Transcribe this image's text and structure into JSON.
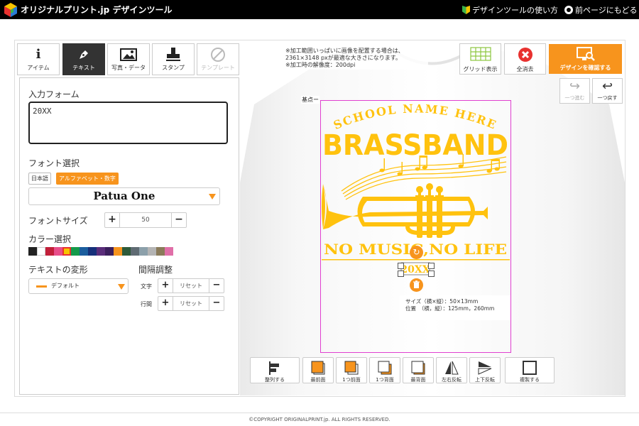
{
  "header": {
    "brand": "オリジナルプリント.jp デザインツール",
    "howto": "デザインツールの使い方",
    "back": "前ページにもどる"
  },
  "tabs": [
    {
      "label": "アイテム",
      "icon": "info-icon"
    },
    {
      "label": "テキスト",
      "icon": "pen-icon",
      "active": true
    },
    {
      "label": "写真・データ",
      "icon": "image-icon"
    },
    {
      "label": "スタンプ",
      "icon": "stamp-icon"
    },
    {
      "label": "テンプレート",
      "icon": "template-icon",
      "disabled": true
    }
  ],
  "form": {
    "input_label": "入力フォーム",
    "input_value": "20XX",
    "font_label": "フォント選択",
    "font_tab_jp": "日本語",
    "font_tab_alpha": "アルファベット・数字",
    "font_value": "Patua One",
    "size_label": "フォントサイズ",
    "size_plus": "+",
    "size_value": "50",
    "size_minus": "−",
    "color_label": "カラー選択",
    "transform_label": "テキストの変形",
    "transform_value": "デフォルト",
    "spacing_label": "間隔調整",
    "char_label": "文字",
    "line_label": "行間",
    "reset": "リセット",
    "plus": "+",
    "minus": "−"
  },
  "palette": [
    "#222222",
    "#ffffff",
    "#c21f3a",
    "#e84d8a",
    "#f7c400",
    "#159a4b",
    "#1b5e9e",
    "#16307a",
    "#5a2d7a",
    "#3b1f5c",
    "#f7941d",
    "#2d5a3a",
    "#5f6b73",
    "#8ca0aa",
    "#b4b4b4",
    "#8a7b5a",
    "#e06fa8"
  ],
  "notes": {
    "line1": "※加工範囲いっぱいに画像を配置する場合は、",
    "line2": "2361×3148 pxが最適な大きさになります。",
    "line3": "※加工時の解像度：200dpi"
  },
  "canvas_tools": {
    "grid": "グリッド表示",
    "clear": "全消去",
    "confirm": "デザインを確認する",
    "redo": "一つ進む",
    "undo": "一つ戻す",
    "origin": "基点ー"
  },
  "design": {
    "school": "SCHOOL NAME HERE",
    "title": "BRASSBAND",
    "slogan": "NO MUSIC,NO LIFE",
    "year": "20XX",
    "color": "#ffc20e"
  },
  "size_info": {
    "size": "サイズ（横×縦）：50×13mm",
    "pos": "位置　（横，縦）：125mm，260mm"
  },
  "bottom_tools": [
    "整列する",
    "最前面",
    "1つ前面",
    "1つ背面",
    "最背面",
    "左右反転",
    "上下反転",
    "複製する"
  ],
  "footer": "©COPYRIGHT ORIGINALPRINT.jp. ALL RIGHTS RESERVED."
}
